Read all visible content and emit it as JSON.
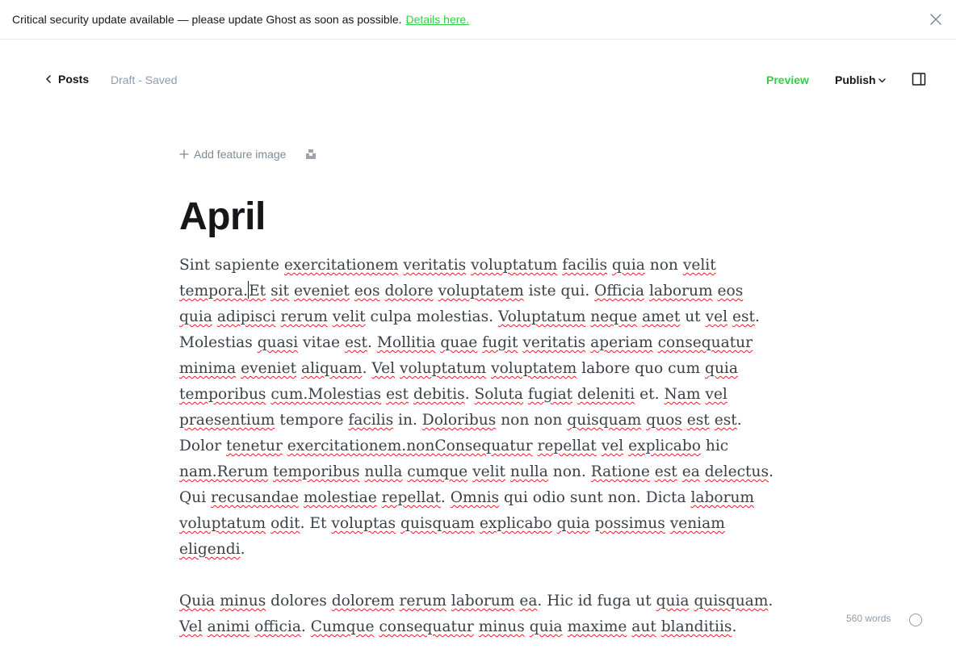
{
  "banner": {
    "message": "Critical security update available — please update Ghost as soon as possible.",
    "link_label": "Details here."
  },
  "header": {
    "back_label": "Posts",
    "status": "Draft - Saved",
    "preview_label": "Preview",
    "publish_label": "Publish"
  },
  "editor": {
    "feature_image_label": "Add feature image",
    "title": "April",
    "paragraph1_segments": [
      {
        "t": "Sint sapiente ",
        "u": false
      },
      {
        "t": "exercitationem",
        "u": true
      },
      {
        "t": " ",
        "u": false
      },
      {
        "t": "veritatis",
        "u": true
      },
      {
        "t": " ",
        "u": false
      },
      {
        "t": "voluptatum",
        "u": true
      },
      {
        "t": " ",
        "u": false
      },
      {
        "t": "facilis",
        "u": true
      },
      {
        "t": " ",
        "u": false
      },
      {
        "t": "quia",
        "u": true
      },
      {
        "t": " non ",
        "u": false
      },
      {
        "t": "velit",
        "u": true
      },
      {
        "t": " ",
        "u": false
      },
      {
        "t": "tempora.",
        "u": true
      },
      {
        "t": "|",
        "caret": true
      },
      {
        "t": "Et",
        "u": true
      },
      {
        "t": " ",
        "u": false
      },
      {
        "t": "sit",
        "u": true
      },
      {
        "t": " ",
        "u": false
      },
      {
        "t": "eveniet",
        "u": true
      },
      {
        "t": " ",
        "u": false
      },
      {
        "t": "eos",
        "u": true
      },
      {
        "t": " ",
        "u": false
      },
      {
        "t": "dolore",
        "u": true
      },
      {
        "t": " ",
        "u": false
      },
      {
        "t": "voluptatem",
        "u": true
      },
      {
        "t": " iste qui. ",
        "u": false
      },
      {
        "t": "Officia",
        "u": true
      },
      {
        "t": " ",
        "u": false
      },
      {
        "t": "laborum",
        "u": true
      },
      {
        "t": " ",
        "u": false
      },
      {
        "t": "eos",
        "u": true
      },
      {
        "t": " ",
        "u": false
      },
      {
        "t": "quia",
        "u": true
      },
      {
        "t": " ",
        "u": false
      },
      {
        "t": "adipisci",
        "u": true
      },
      {
        "t": " ",
        "u": false
      },
      {
        "t": "rerum",
        "u": true
      },
      {
        "t": " ",
        "u": false
      },
      {
        "t": "velit",
        "u": true
      },
      {
        "t": " culpa molestias. ",
        "u": false
      },
      {
        "t": "Voluptatum",
        "u": true
      },
      {
        "t": " ",
        "u": false
      },
      {
        "t": "neque",
        "u": true
      },
      {
        "t": " ",
        "u": false
      },
      {
        "t": "amet",
        "u": true
      },
      {
        "t": " ut ",
        "u": false
      },
      {
        "t": "vel",
        "u": true
      },
      {
        "t": " ",
        "u": false
      },
      {
        "t": "est",
        "u": true
      },
      {
        "t": ". Molestias ",
        "u": false
      },
      {
        "t": "quasi",
        "u": true
      },
      {
        "t": " vitae ",
        "u": false
      },
      {
        "t": "est",
        "u": true
      },
      {
        "t": ". ",
        "u": false
      },
      {
        "t": "Mollitia",
        "u": true
      },
      {
        "t": " ",
        "u": false
      },
      {
        "t": "quae",
        "u": true
      },
      {
        "t": " ",
        "u": false
      },
      {
        "t": "fugit",
        "u": true
      },
      {
        "t": " ",
        "u": false
      },
      {
        "t": "veritatis",
        "u": true
      },
      {
        "t": " ",
        "u": false
      },
      {
        "t": "aperiam",
        "u": true
      },
      {
        "t": " ",
        "u": false
      },
      {
        "t": "consequatur",
        "u": true
      },
      {
        "t": " ",
        "u": false
      },
      {
        "t": "minima",
        "u": true
      },
      {
        "t": " ",
        "u": false
      },
      {
        "t": "eveniet",
        "u": true
      },
      {
        "t": " ",
        "u": false
      },
      {
        "t": "aliquam",
        "u": true
      },
      {
        "t": ". ",
        "u": false
      },
      {
        "t": "Vel",
        "u": true
      },
      {
        "t": " ",
        "u": false
      },
      {
        "t": "voluptatum",
        "u": true
      },
      {
        "t": " ",
        "u": false
      },
      {
        "t": "voluptatem",
        "u": true
      },
      {
        "t": " labore quo cum ",
        "u": false
      },
      {
        "t": "quia",
        "u": true
      },
      {
        "t": " ",
        "u": false
      },
      {
        "t": "temporibus",
        "u": true
      },
      {
        "t": " ",
        "u": false
      },
      {
        "t": "cum.Molestias",
        "u": true
      },
      {
        "t": " ",
        "u": false
      },
      {
        "t": "est",
        "u": true
      },
      {
        "t": " ",
        "u": false
      },
      {
        "t": "debitis",
        "u": true
      },
      {
        "t": ". ",
        "u": false
      },
      {
        "t": "Soluta",
        "u": true
      },
      {
        "t": " ",
        "u": false
      },
      {
        "t": "fugiat",
        "u": true
      },
      {
        "t": " ",
        "u": false
      },
      {
        "t": "deleniti",
        "u": true
      },
      {
        "t": " et. ",
        "u": false
      },
      {
        "t": "Nam",
        "u": true
      },
      {
        "t": " ",
        "u": false
      },
      {
        "t": "vel",
        "u": true
      },
      {
        "t": " ",
        "u": false
      },
      {
        "t": "praesentium",
        "u": true
      },
      {
        "t": " tempore ",
        "u": false
      },
      {
        "t": "facilis",
        "u": true
      },
      {
        "t": " in. ",
        "u": false
      },
      {
        "t": "Doloribus",
        "u": true
      },
      {
        "t": " ",
        "u": false
      },
      {
        "t": "non non ",
        "u": false
      },
      {
        "t": "quisquam",
        "u": true
      },
      {
        "t": " ",
        "u": false
      },
      {
        "t": "quos",
        "u": true
      },
      {
        "t": " ",
        "u": false
      },
      {
        "t": "est",
        "u": true
      },
      {
        "t": " ",
        "u": false
      },
      {
        "t": "est",
        "u": true
      },
      {
        "t": ". Dolor ",
        "u": false
      },
      {
        "t": "tenetur",
        "u": true
      },
      {
        "t": " ",
        "u": false
      },
      {
        "t": "exercitationem.nonConsequatur",
        "u": true
      },
      {
        "t": " ",
        "u": false
      },
      {
        "t": "repellat",
        "u": true
      },
      {
        "t": " ",
        "u": false
      },
      {
        "t": "vel",
        "u": true
      },
      {
        "t": " ",
        "u": false
      },
      {
        "t": "explicabo",
        "u": true
      },
      {
        "t": " hic ",
        "u": false
      },
      {
        "t": "nam.Rerum",
        "u": true
      },
      {
        "t": " ",
        "u": false
      },
      {
        "t": "temporibus",
        "u": true
      },
      {
        "t": " ",
        "u": false
      },
      {
        "t": "nulla",
        "u": true
      },
      {
        "t": " ",
        "u": false
      },
      {
        "t": "cumque",
        "u": true
      },
      {
        "t": " ",
        "u": false
      },
      {
        "t": "velit",
        "u": true
      },
      {
        "t": " ",
        "u": false
      },
      {
        "t": "nulla",
        "u": true
      },
      {
        "t": " non. ",
        "u": false
      },
      {
        "t": "Ratione",
        "u": true
      },
      {
        "t": " ",
        "u": false
      },
      {
        "t": "est",
        "u": true
      },
      {
        "t": " ",
        "u": false
      },
      {
        "t": "ea",
        "u": true
      },
      {
        "t": " ",
        "u": false
      },
      {
        "t": "delectus",
        "u": true
      },
      {
        "t": ". Qui ",
        "u": false
      },
      {
        "t": "recusandae",
        "u": true
      },
      {
        "t": " ",
        "u": false
      },
      {
        "t": "molestiae",
        "u": true
      },
      {
        "t": " ",
        "u": false
      },
      {
        "t": "repellat",
        "u": true
      },
      {
        "t": ". ",
        "u": false
      },
      {
        "t": "Omnis",
        "u": true
      },
      {
        "t": " qui odio sunt ",
        "u": false
      },
      {
        "t": "non. Dicta ",
        "u": false
      },
      {
        "t": "laborum",
        "u": true
      },
      {
        "t": " ",
        "u": false
      },
      {
        "t": "voluptatum",
        "u": true
      },
      {
        "t": " ",
        "u": false
      },
      {
        "t": "odit",
        "u": true
      },
      {
        "t": ". Et ",
        "u": false
      },
      {
        "t": "voluptas",
        "u": true
      },
      {
        "t": " ",
        "u": false
      },
      {
        "t": "quisquam",
        "u": true
      },
      {
        "t": " ",
        "u": false
      },
      {
        "t": "explicabo",
        "u": true
      },
      {
        "t": " ",
        "u": false
      },
      {
        "t": "quia",
        "u": true
      },
      {
        "t": " ",
        "u": false
      },
      {
        "t": "possimus",
        "u": true
      },
      {
        "t": " ",
        "u": false
      },
      {
        "t": "veniam",
        "u": true
      },
      {
        "t": " ",
        "u": false
      },
      {
        "t": "eligendi",
        "u": true
      },
      {
        "t": ".",
        "u": false
      }
    ],
    "paragraph2_segments": [
      {
        "t": "Quia",
        "u": true
      },
      {
        "t": " ",
        "u": false
      },
      {
        "t": "minus",
        "u": true
      },
      {
        "t": " dolores ",
        "u": false
      },
      {
        "t": "dolorem",
        "u": true
      },
      {
        "t": " ",
        "u": false
      },
      {
        "t": "rerum",
        "u": true
      },
      {
        "t": " ",
        "u": false
      },
      {
        "t": "laborum",
        "u": true
      },
      {
        "t": " ",
        "u": false
      },
      {
        "t": "ea",
        "u": true
      },
      {
        "t": ". Hic id fuga ut ",
        "u": false
      },
      {
        "t": "quia",
        "u": true
      },
      {
        "t": " ",
        "u": false
      },
      {
        "t": "quisquam",
        "u": true
      },
      {
        "t": ". ",
        "u": false
      },
      {
        "t": "Vel",
        "u": true
      },
      {
        "t": " ",
        "u": false
      },
      {
        "t": "animi",
        "u": true
      },
      {
        "t": " ",
        "u": false
      },
      {
        "t": "officia",
        "u": true
      },
      {
        "t": ". ",
        "u": false
      },
      {
        "t": "Cumque",
        "u": true
      },
      {
        "t": " ",
        "u": false
      },
      {
        "t": "consequatur",
        "u": true
      },
      {
        "t": " ",
        "u": false
      },
      {
        "t": "minus",
        "u": true
      },
      {
        "t": " ",
        "u": false
      },
      {
        "t": "quia",
        "u": true
      },
      {
        "t": " ",
        "u": false
      },
      {
        "t": "maxime",
        "u": true
      },
      {
        "t": " ",
        "u": false
      },
      {
        "t": "aut",
        "u": true
      },
      {
        "t": " ",
        "u": false
      },
      {
        "t": "blanditiis",
        "u": true
      },
      {
        "t": ".",
        "u": false
      }
    ]
  },
  "footer": {
    "word_count": "560 words"
  },
  "colors": {
    "accent": "#30cf43",
    "spellcheck": "#e02020",
    "muted": "#8e9cac"
  }
}
